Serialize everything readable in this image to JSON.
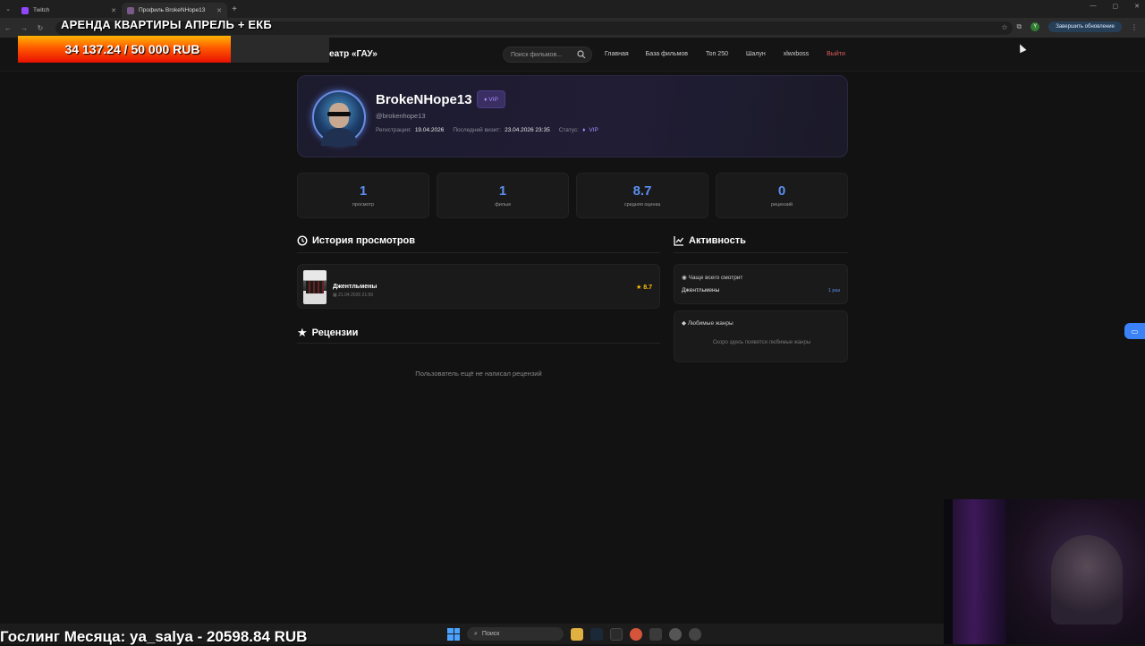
{
  "browser": {
    "tabs": [
      {
        "title": "Twitch",
        "active": false
      },
      {
        "title": "Профиль BrokeNHope13",
        "active": true
      }
    ],
    "update_button": "Завершить обновление",
    "profile_initial": "Y"
  },
  "site": {
    "brand": "Кинотеатр «ГАУ»",
    "search_placeholder": "Поиск фильмов...",
    "nav": [
      "Главная",
      "База фильмов",
      "Топ 250",
      "Шалун",
      "xlwxboss"
    ],
    "logout": "Выйти"
  },
  "overlay": {
    "title": "АРЕНДА КВАРТИРЫ АПРЕЛЬ + ЕКБ",
    "progress_text": "34 137.24 / 50 000 RUB",
    "progress_fraction": 0.683,
    "bottom_text": "Гослинг Месяца: ya_salya - 20598.84 RUB"
  },
  "profile": {
    "username": "BrokeNHope13",
    "badge": "VIP",
    "handle": "@brokenhope13",
    "reg_label": "Регистрация:",
    "reg_date": "19.04.2026",
    "last_label": "Последний визит:",
    "last_date": "23.04.2026 23:35",
    "status_label": "Статус:",
    "status": "VIP"
  },
  "stats": [
    {
      "value": "1",
      "label": "просмотр"
    },
    {
      "value": "1",
      "label": "фильм"
    },
    {
      "value": "8.7",
      "label": "средняя оценка"
    },
    {
      "value": "0",
      "label": "рецензий"
    }
  ],
  "history": {
    "heading": "История просмотров",
    "items": [
      {
        "title": "Джентльмены",
        "date": "21.04.2026 21:59",
        "rating": "8.7"
      }
    ]
  },
  "reviews": {
    "heading": "Рецензии",
    "empty": "Пользователь ещё не написал рецензий"
  },
  "activity": {
    "heading": "Активность",
    "most_watched_label": "Чаще всего смотрит",
    "most_watched_title": "Джентльмены",
    "most_watched_count": "1 раз",
    "genres_label": "Любимые жанры",
    "genres_empty": "Скоро здесь появятся любимые жанры"
  },
  "taskbar": {
    "search": "Поиск"
  },
  "colors": {
    "accent": "#5b8ff0",
    "vip": "#a98cff",
    "rating": "#ffc107",
    "logout": "#e05a5a"
  }
}
